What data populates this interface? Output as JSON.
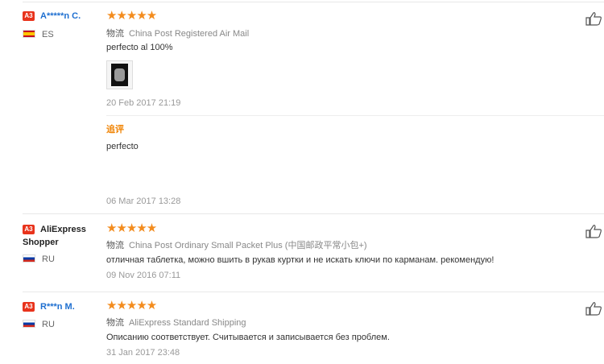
{
  "reviews": [
    {
      "level": "A3",
      "name": "A*****n C.",
      "country": "ES",
      "stars": "★★★★★",
      "shipping_label": "物流",
      "shipping": "China Post Registered Air Mail",
      "text": "perfecto al 100%",
      "date": "20 Feb 2017 21:19",
      "additional_label": "追评",
      "additional_text": "perfecto",
      "additional_date": "06 Mar 2017 13:28"
    },
    {
      "level": "A3",
      "name_line1": "AliExpress",
      "name_line2": "Shopper",
      "country": "RU",
      "stars": "★★★★★",
      "shipping_label": "物流",
      "shipping": "China Post Ordinary Small Packet Plus (中国邮政平常小包+)",
      "text": "отличная таблетка, можно вшить в рукав куртки и не искать ключи по карманам. рекомендую!",
      "date": "09 Nov 2016 07:11"
    },
    {
      "level": "A3",
      "name": "R***n M.",
      "country": "RU",
      "stars": "★★★★★",
      "shipping_label": "物流",
      "shipping": "AliExpress Standard Shipping",
      "text": "Описанию соответствует. Считывается и записывается без проблем.",
      "date": "31 Jan 2017 23:48"
    }
  ]
}
